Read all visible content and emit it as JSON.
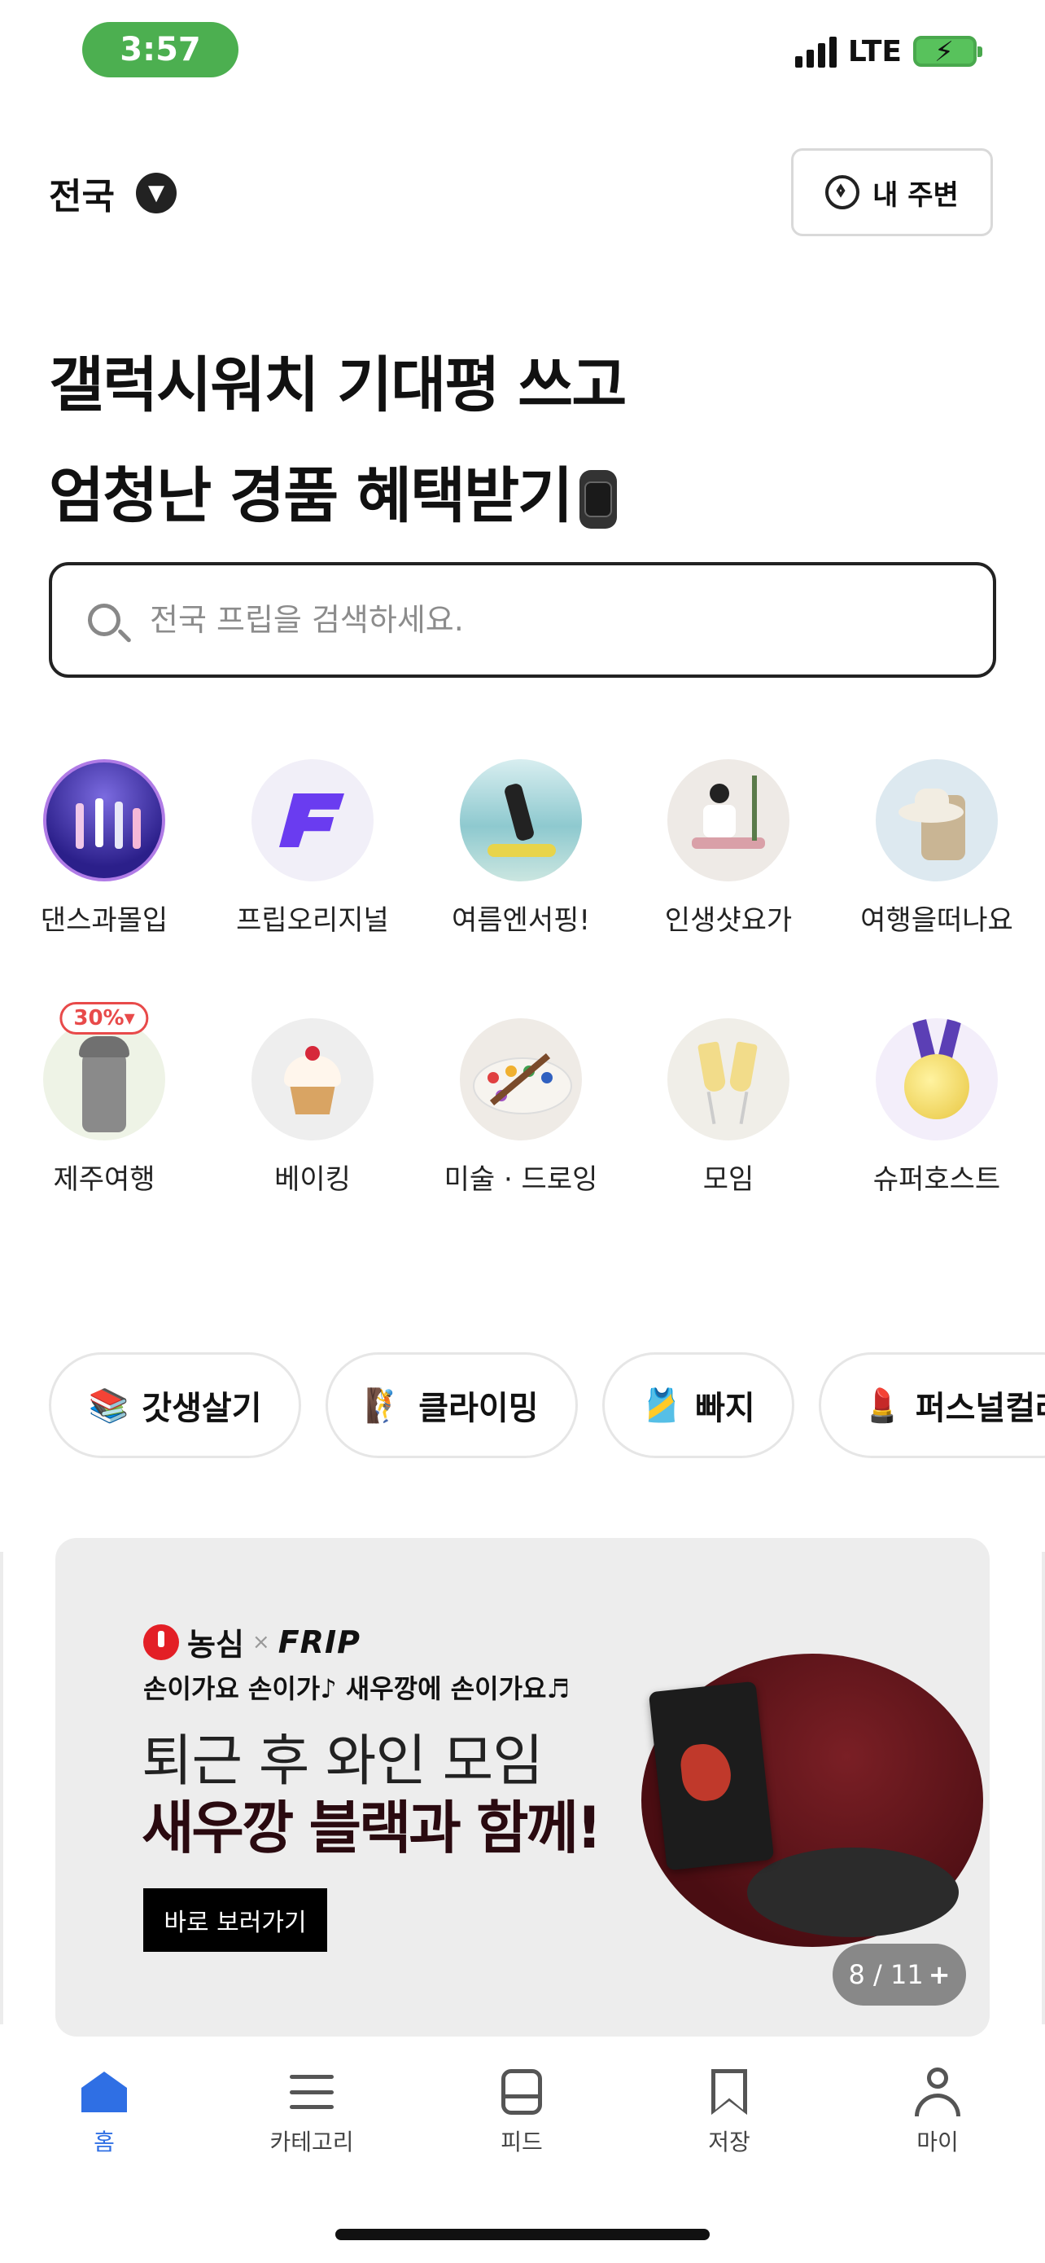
{
  "status": {
    "time": "3:57",
    "network": "LTE"
  },
  "header": {
    "region": "전국",
    "nearby_label": "내 주변"
  },
  "hero": {
    "line1": "갤럭시워치 기대평 쓰고",
    "line2": "엄청난 경품 혜택받기"
  },
  "search": {
    "placeholder": "전국 프립을 검색하세요."
  },
  "categories": [
    {
      "label": "댄스과몰입",
      "icon": "dance-photo"
    },
    {
      "label": "프립오리지널",
      "icon": "frip-logo"
    },
    {
      "label": "여름엔서핑!",
      "icon": "surf-photo"
    },
    {
      "label": "인생샷요가",
      "icon": "yoga-photo"
    },
    {
      "label": "여행을떠나요",
      "icon": "luggage-photo"
    },
    {
      "label": "제주여행",
      "icon": "jeju-statue-photo",
      "badge": "30%▾"
    },
    {
      "label": "베이킹",
      "icon": "cupcake-photo"
    },
    {
      "label": "미술 · 드로잉",
      "icon": "palette-photo"
    },
    {
      "label": "모임",
      "icon": "champagne-photo"
    },
    {
      "label": "슈퍼호스트",
      "icon": "medal-photo"
    }
  ],
  "chips": [
    {
      "label": "갓생살기",
      "emoji": "📚"
    },
    {
      "label": "클라이밍",
      "emoji": "🧗"
    },
    {
      "label": "빠지",
      "emoji": "🎽"
    },
    {
      "label": "퍼스널컬러",
      "emoji": "💄"
    }
  ],
  "banner": {
    "brand": "농심",
    "partner": "FRIP",
    "subtitle": "손이가요 손이가♪ 새우깡에 손이가요♬",
    "line1": "퇴근 후 와인 모임",
    "line2": "새우깡 블랙과 함께!",
    "cta": "바로 보러가기",
    "counter": "8 / 11"
  },
  "tabs": [
    {
      "label": "홈",
      "active": true
    },
    {
      "label": "카테고리"
    },
    {
      "label": "피드"
    },
    {
      "label": "저장"
    },
    {
      "label": "마이"
    }
  ],
  "colors": {
    "accent": "#2f6fe4",
    "status_pill": "#4caf50",
    "badge": "#e84a4a"
  }
}
